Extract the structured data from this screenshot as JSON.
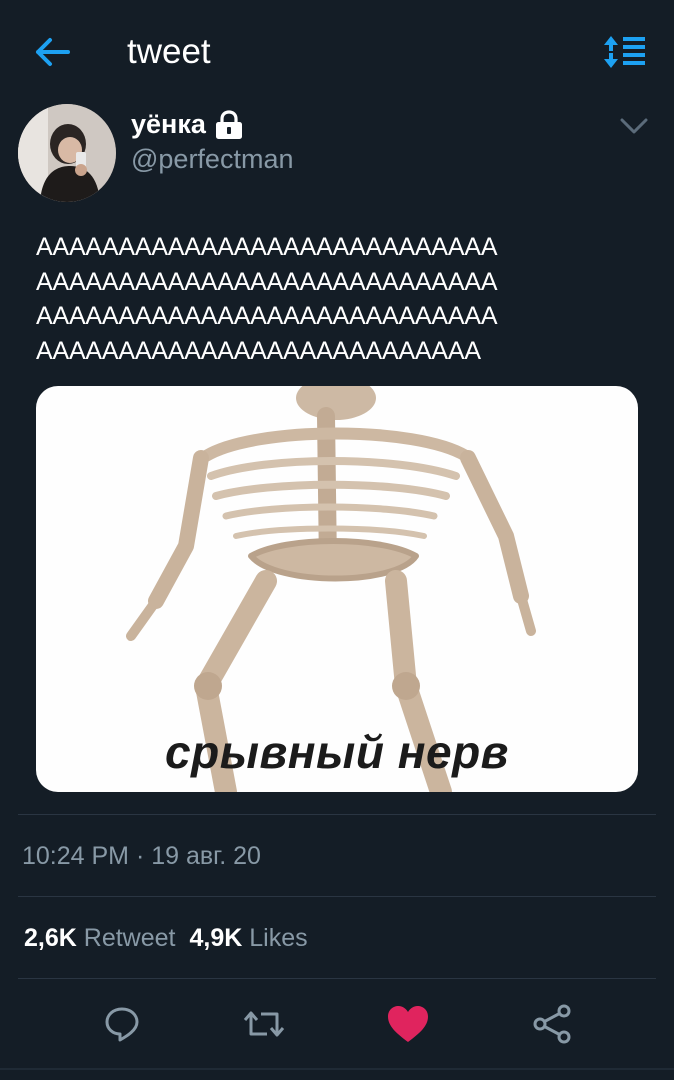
{
  "header": {
    "title": "tweet",
    "back_icon": "arrow-left-icon",
    "sort_icon": "sort-icon"
  },
  "author": {
    "display_name": "уёнка",
    "handle": "@perfectman",
    "protected_icon": "lock-icon"
  },
  "tweet": {
    "text": "AAAAAAAAAAAAAAAAAAAAAAAAAAAA\nAAAAAAAAAAAAAAAAAAAAAAAAAAAA\nAAAAAAAAAAAAAAAAAAAAAAAAAAAA\nAAAAAAAAAAAAAAAAAAAAAAAAAAA",
    "media_caption": "срывный нерв",
    "timestamp": "10:24 PM · 19 авг. 20"
  },
  "stats": {
    "retweets_count": "2,6K",
    "retweets_label": "Retweet",
    "likes_count": "4,9K",
    "likes_label": "Likes"
  },
  "actions": {
    "reply_icon": "reply-icon",
    "retweet_icon": "retweet-icon",
    "like_icon": "heart-icon",
    "share_icon": "share-icon"
  },
  "colors": {
    "background": "#141d26",
    "accent": "#1da1f2",
    "like": "#e0245e",
    "muted": "#8899a6"
  }
}
